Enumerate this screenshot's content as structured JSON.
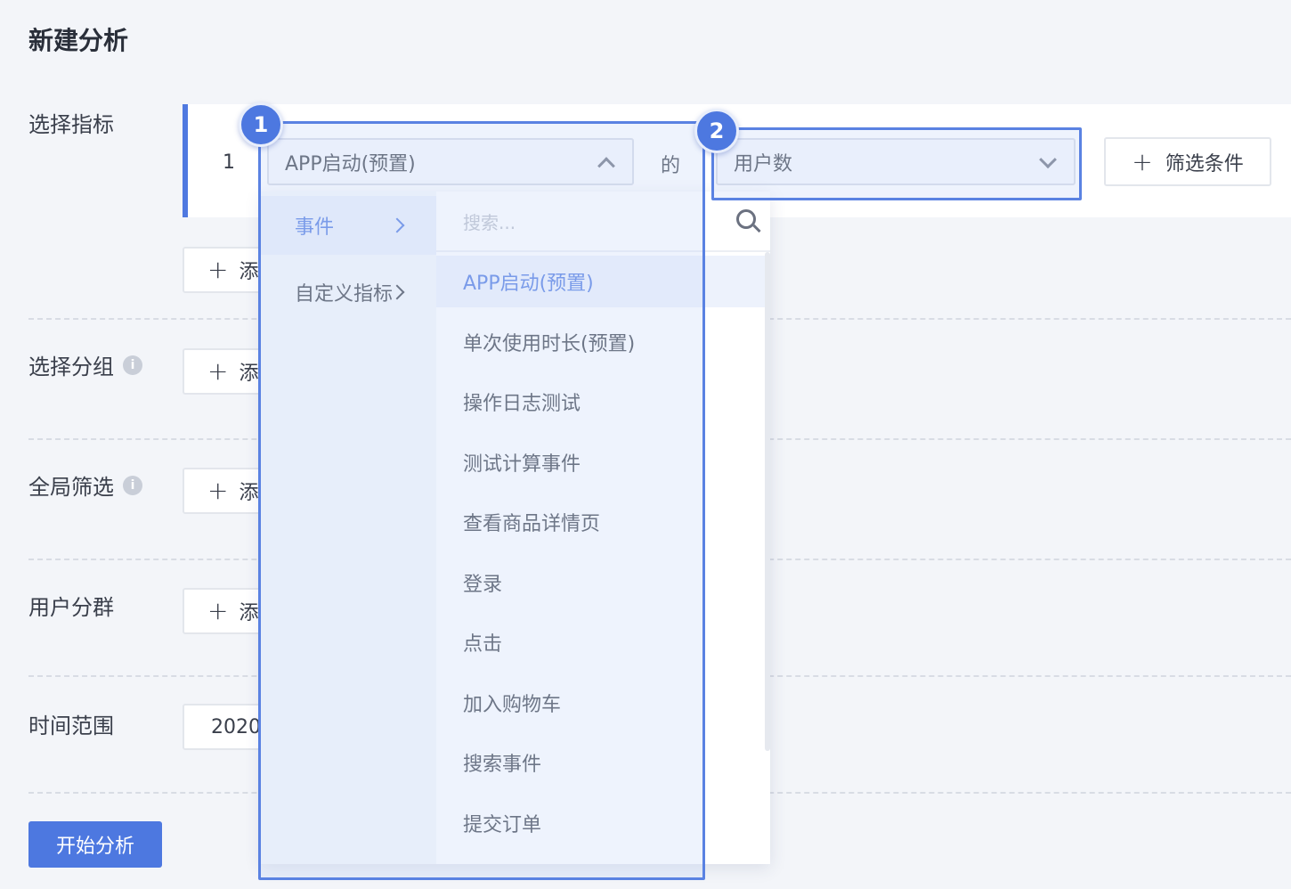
{
  "page": {
    "title": "新建分析"
  },
  "rows": {
    "metric": "选择指标",
    "group": "选择分组",
    "global_filter": "全局筛选",
    "user_segment": "用户分群",
    "time_range": "时间范围"
  },
  "metric_row": {
    "index": "1",
    "event_value": "APP启动(预置)",
    "connector": "的",
    "measure_value": "用户数",
    "filter_button": "筛选条件"
  },
  "add_button_label": "添加",
  "date_value": "2020-",
  "start_button": "开始分析",
  "badges": {
    "one": "1",
    "two": "2"
  },
  "dropdown": {
    "categories": [
      "事件",
      "自定义指标"
    ],
    "search_placeholder": "搜索...",
    "items": [
      "APP启动(预置)",
      "单次使用时长(预置)",
      "操作日志测试",
      "测试计算事件",
      "查看商品详情页",
      "登录",
      "点击",
      "加入购物车",
      "搜索事件",
      "提交订单"
    ]
  },
  "colors": {
    "accent": "#4d78e0",
    "background": "#f3f5f9",
    "highlight_border": "#5a82e2"
  }
}
